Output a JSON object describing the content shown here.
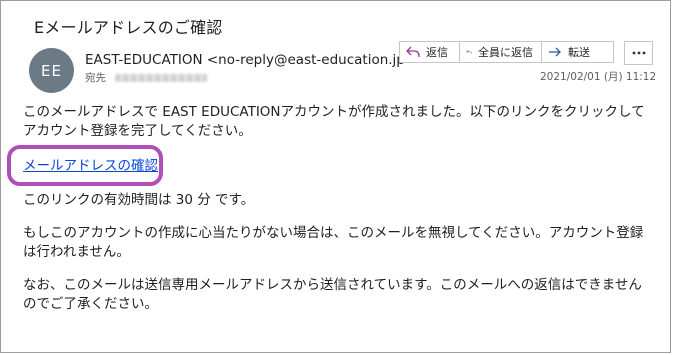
{
  "email": {
    "subject": "Eメールアドレスのご確認",
    "avatar_initials": "EE",
    "sender": "EAST-EDUCATION <no-reply@east-education.jp",
    "to_label": "宛先",
    "date": "2021/02/01 (月) 11:12"
  },
  "actions": {
    "reply": "返信",
    "reply_all": "全員に返信",
    "forward": "転送"
  },
  "body": {
    "intro": "このメールアドレスで EAST EDUCATIONアカウントが作成されました。以下のリンクをクリックしてアカウント登録を完了してください。",
    "link_text": "メールアドレスの確認",
    "validity": "このリンクの有効時間は 30 分 です。",
    "ignore_notice": "もしこのアカウントの作成に心当たりがない場合は、このメールを無視してください。アカウント登録は行われません。",
    "noreply_notice": "なお、このメールは送信専用メールアドレスから送信されています。このメールへの返信はできませんのでご了承ください。"
  },
  "colors": {
    "link": "#0b46d8",
    "highlight": "#b04fb7",
    "action_icon": "#8a3d8f",
    "forward_icon": "#2f5f9f"
  }
}
